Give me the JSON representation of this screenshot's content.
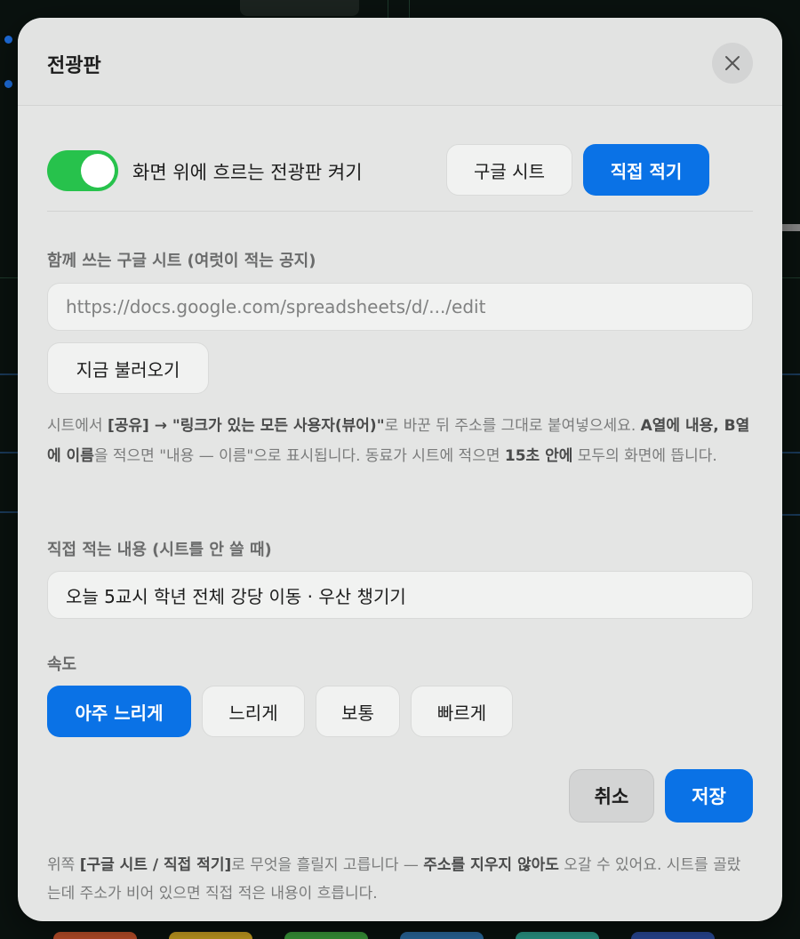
{
  "modal": {
    "title": "전광판",
    "toggle_label": "화면 위에 흐르는 전광판 켜기",
    "toggle_on": true,
    "source_options": [
      "구글 시트",
      "직접 적기"
    ],
    "source_selected": "직접 적기",
    "sheet": {
      "label": "함께 쓰는 구글 시트 (여럿이 적는 공지)",
      "placeholder": "https://docs.google.com/spreadsheets/d/.../edit",
      "load_button": "지금 불러오기",
      "help": {
        "p1": "시트에서 ",
        "b1": "[공유] → \"링크가 있는 모든 사용자(뷰어)\"",
        "p2": "로 바꾼 뒤 주소를 그대로 붙여넣으세요. ",
        "b2": "A열에 내용, B열에 이름",
        "p3": "을 적으면 \"내용 — 이름\"으로 표시됩니다. 동료가 시트에 적으면 ",
        "b3": "15초 안에",
        "p4": " 모두의 화면에 뜹니다."
      }
    },
    "direct": {
      "label": "직접 적는 내용 (시트를 안 쓸 때)",
      "value": "오늘 5교시 학년 전체 강당 이동 · 우산 챙기기"
    },
    "speed": {
      "label": "속도",
      "options": [
        "아주 느리게",
        "느리게",
        "보통",
        "빠르게"
      ],
      "selected": "아주 느리게"
    },
    "cancel_label": "취소",
    "save_label": "저장",
    "footer": {
      "p1": "위쪽 ",
      "b1": "[구글 시트 / 직접 적기]",
      "p2": "로 무엇을 흘릴지 고릅니다 — ",
      "b2": "주소를 지우지 않아도",
      "p3": " 오갈 수 있어요. 시트를 골랐는데 주소가 비어 있으면 직접 적은 내용이 흐릅니다."
    }
  },
  "colors": {
    "accent": "#0a72e6",
    "toggle_on": "#27c24c",
    "modal_bg": "#e4e5e4"
  },
  "icons": {
    "close": "close-icon"
  }
}
